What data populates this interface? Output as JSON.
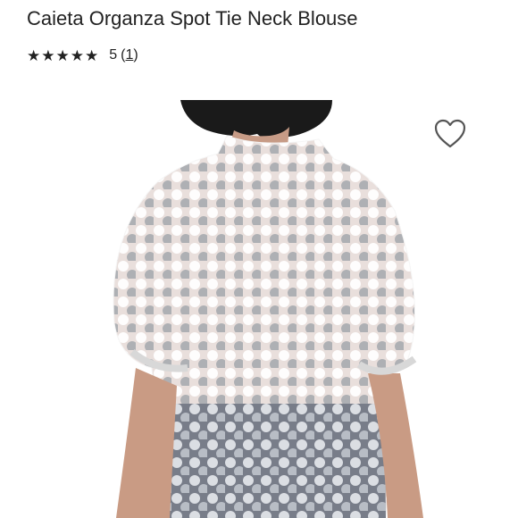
{
  "product": {
    "title": "Caieta Organza Spot Tie Neck Blouse",
    "rating": {
      "stars": 5,
      "value_text": "5",
      "count_text": "1"
    }
  },
  "actions": {
    "favorite_icon": "heart-outline-icon"
  },
  "colors": {
    "text": "#222222",
    "star": "#1a1a1a",
    "background": "#ffffff"
  }
}
